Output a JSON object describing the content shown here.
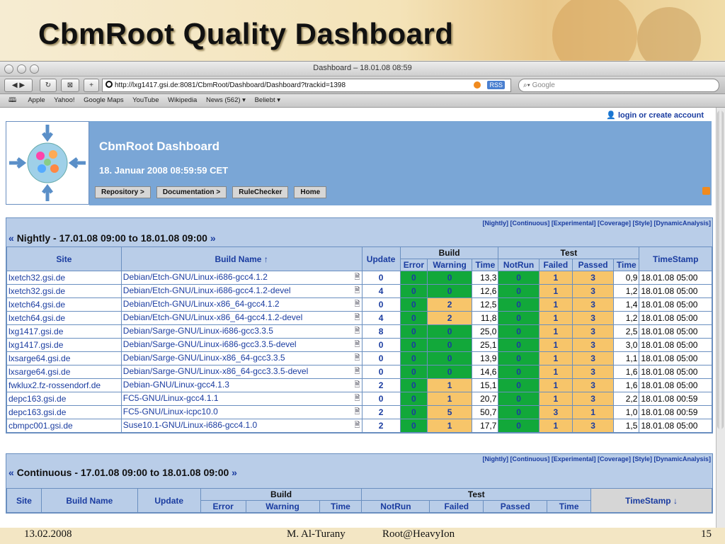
{
  "slide": {
    "title": "CbmRoot Quality Dashboard",
    "footer_date": "13.02.2008",
    "footer_author": "M. Al-Turany",
    "footer_event": "Root@HeavyIon",
    "footer_page": "15"
  },
  "browser": {
    "window_title": "Dashboard – 18.01.08 08:59",
    "url": "http://lxg1417.gsi.de:8081/CbmRoot/Dashboard/Dashboard?trackid=1398",
    "search_placeholder": "Google",
    "rss_label": "RSS",
    "bookmarks": [
      "Apple",
      "Yahoo!",
      "Google Maps",
      "YouTube",
      "Wikipedia",
      "News (562) ▾",
      "Beliebt ▾"
    ]
  },
  "header": {
    "login": "login or create account",
    "dashboard_title": "CbmRoot Dashboard",
    "dashboard_date": "18. Januar 2008 08:59:59 CET",
    "nav": [
      "Repository >",
      "Documentation >",
      "RuleChecker",
      "Home"
    ]
  },
  "type_links": "[Nightly] [Continuous] [Experimental] [Coverage] [Style] [DynamicAnalysis]",
  "nightly": {
    "title_prefix": "« ",
    "title": "Nightly - 17.01.08 09:00 to 18.01.08 09:00",
    "title_suffix": " »",
    "col_site": "Site",
    "col_build_name": "Build Name ↑",
    "col_update": "Update",
    "col_build": "Build",
    "col_error": "Error",
    "col_warning": "Warning",
    "col_time": "Time",
    "col_test": "Test",
    "col_notrun": "NotRun",
    "col_failed": "Failed",
    "col_passed": "Passed",
    "col_test_time": "Time",
    "col_timestamp": "TimeStamp",
    "rows": [
      {
        "site": "lxetch32.gsi.de",
        "build": "Debian/Etch-GNU/Linux-i686-gcc4.1.2",
        "update": "0",
        "error": "0",
        "warning": "0",
        "wclass": "g",
        "time": "13,3",
        "notrun": "0",
        "failed": "1",
        "passed": "3",
        "ttime": "0,9",
        "ts": "18.01.08 05:00"
      },
      {
        "site": "lxetch32.gsi.de",
        "build": "Debian/Etch-GNU/Linux-i686-gcc4.1.2-devel",
        "update": "4",
        "error": "0",
        "warning": "0",
        "wclass": "g",
        "time": "12,6",
        "notrun": "0",
        "failed": "1",
        "passed": "3",
        "ttime": "1,2",
        "ts": "18.01.08 05:00"
      },
      {
        "site": "lxetch64.gsi.de",
        "build": "Debian/Etch-GNU/Linux-x86_64-gcc4.1.2",
        "update": "0",
        "error": "0",
        "warning": "2",
        "wclass": "o",
        "time": "12,5",
        "notrun": "0",
        "failed": "1",
        "passed": "3",
        "ttime": "1,4",
        "ts": "18.01.08 05:00"
      },
      {
        "site": "lxetch64.gsi.de",
        "build": "Debian/Etch-GNU/Linux-x86_64-gcc4.1.2-devel",
        "update": "4",
        "error": "0",
        "warning": "2",
        "wclass": "o",
        "time": "11,8",
        "notrun": "0",
        "failed": "1",
        "passed": "3",
        "ttime": "1,2",
        "ts": "18.01.08 05:00"
      },
      {
        "site": "lxg1417.gsi.de",
        "build": "Debian/Sarge-GNU/Linux-i686-gcc3.3.5",
        "update": "8",
        "error": "0",
        "warning": "0",
        "wclass": "g",
        "time": "25,0",
        "notrun": "0",
        "failed": "1",
        "passed": "3",
        "ttime": "2,5",
        "ts": "18.01.08 05:00"
      },
      {
        "site": "lxg1417.gsi.de",
        "build": "Debian/Sarge-GNU/Linux-i686-gcc3.3.5-devel",
        "update": "0",
        "error": "0",
        "warning": "0",
        "wclass": "g",
        "time": "25,1",
        "notrun": "0",
        "failed": "1",
        "passed": "3",
        "ttime": "3,0",
        "ts": "18.01.08 05:00"
      },
      {
        "site": "lxsarge64.gsi.de",
        "build": "Debian/Sarge-GNU/Linux-x86_64-gcc3.3.5",
        "update": "0",
        "error": "0",
        "warning": "0",
        "wclass": "g",
        "time": "13,9",
        "notrun": "0",
        "failed": "1",
        "passed": "3",
        "ttime": "1,1",
        "ts": "18.01.08 05:00"
      },
      {
        "site": "lxsarge64.gsi.de",
        "build": "Debian/Sarge-GNU/Linux-x86_64-gcc3.3.5-devel",
        "update": "0",
        "error": "0",
        "warning": "0",
        "wclass": "g",
        "time": "14,6",
        "notrun": "0",
        "failed": "1",
        "passed": "3",
        "ttime": "1,6",
        "ts": "18.01.08 05:00"
      },
      {
        "site": "fwklux2.fz-rossendorf.de",
        "build": "Debian-GNU/Linux-gcc4.1.3",
        "update": "2",
        "error": "0",
        "warning": "1",
        "wclass": "o",
        "time": "15,1",
        "notrun": "0",
        "failed": "1",
        "passed": "3",
        "ttime": "1,6",
        "ts": "18.01.08 05:00"
      },
      {
        "site": "depc163.gsi.de",
        "build": "FC5-GNU/Linux-gcc4.1.1",
        "update": "0",
        "error": "0",
        "warning": "1",
        "wclass": "o",
        "time": "20,7",
        "notrun": "0",
        "failed": "1",
        "passed": "3",
        "ttime": "2,2",
        "ts": "18.01.08 00:59"
      },
      {
        "site": "depc163.gsi.de",
        "build": "FC5-GNU/Linux-icpc10.0",
        "update": "2",
        "error": "0",
        "warning": "5",
        "wclass": "o",
        "time": "50,7",
        "notrun": "0",
        "failed": "3",
        "passed": "1",
        "ttime": "1,0",
        "ts": "18.01.08 00:59"
      },
      {
        "site": "cbmpc001.gsi.de",
        "build": "Suse10.1-GNU/Linux-i686-gcc4.1.0",
        "update": "2",
        "error": "0",
        "warning": "1",
        "wclass": "o",
        "time": "17,7",
        "notrun": "0",
        "failed": "1",
        "passed": "3",
        "ttime": "1,5",
        "ts": "18.01.08 05:00"
      }
    ]
  },
  "continuous": {
    "title_prefix": "« ",
    "title": "Continuous - 17.01.08 09:00 to 18.01.08 09:00",
    "title_suffix": " »",
    "col_site": "Site",
    "col_build_name": "Build Name",
    "col_update": "Update",
    "col_build": "Build",
    "col_error": "Error",
    "col_warning": "Warning",
    "col_time": "Time",
    "col_test": "Test",
    "col_notrun": "NotRun",
    "col_failed": "Failed",
    "col_passed": "Passed",
    "col_test_time": "Time",
    "col_timestamp": "TimeStamp ↓"
  },
  "colors": {
    "pass": "#12a83a",
    "warn": "#f7c56a",
    "header": "#b9cde8",
    "banner": "#7aa6d6",
    "link": "#1a3ca0"
  }
}
